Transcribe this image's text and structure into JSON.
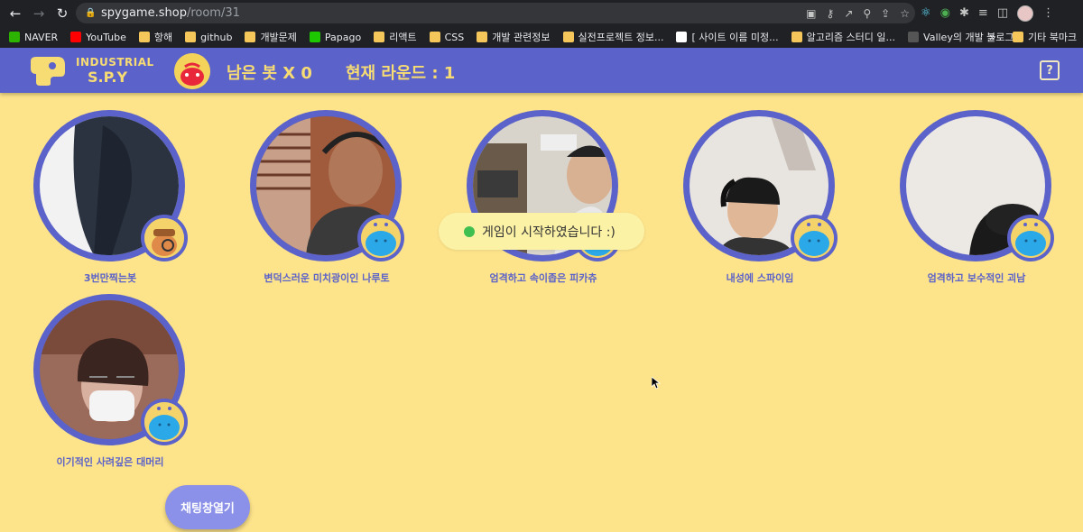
{
  "browser": {
    "url_host": "spygame.shop",
    "url_path": "/room/31",
    "bookmarks": [
      "NAVER",
      "YouTube",
      "항해",
      "github",
      "개발문제",
      "Papago",
      "리액트",
      "CSS",
      "개발 관련정보",
      "실전프로젝트 정보...",
      "[ 사이트 이름 미정...",
      "알고리즘 스터디 일...",
      "Valley의 개발 블로그"
    ],
    "bookmarks_more": "»",
    "other_bookmarks": "기타 북마크"
  },
  "header": {
    "logo_line1": "INDUSTRIAL",
    "logo_line2": "S.P.Y",
    "bots_left": "남은 봇 X 0",
    "round": "현재 라운드 : 1",
    "help_icon": "?"
  },
  "players": [
    {
      "name": "3번만찍는봇",
      "badge": "detective"
    },
    {
      "name": "변덕스러운 미치광이인 나루토",
      "badge": "blob"
    },
    {
      "name": "엄격하고 속이좁은 피카츄",
      "badge": "blob"
    },
    {
      "name": "내성에 스파이임",
      "badge": "blob"
    },
    {
      "name": "엄격하고 보수적인 괴남",
      "badge": "blob"
    },
    {
      "name": "이기적인 사려깊은 대머리",
      "badge": "blob"
    }
  ],
  "toast": {
    "text": "게임이 시작하였습니다 :)",
    "status_color": "#3fbf4f"
  },
  "chat_button": "채팅창열기",
  "colors": {
    "background": "#fde38a",
    "accent": "#5b62c9",
    "logo_yellow": "#f7dc74",
    "chat_button": "#8b90e8"
  }
}
